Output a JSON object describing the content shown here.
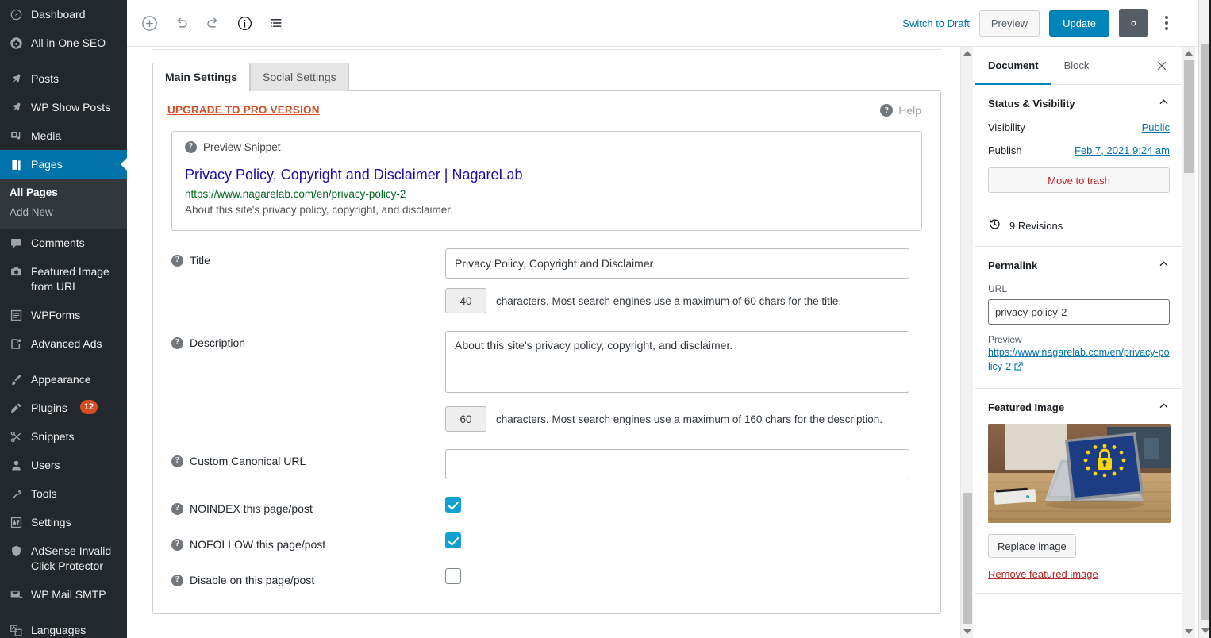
{
  "sidebar": {
    "items": [
      {
        "label": "Dashboard",
        "icon": "dashboard-icon",
        "active": false
      },
      {
        "label": "All in One SEO",
        "icon": "aioseo-icon",
        "active": false
      },
      {
        "label": "Posts",
        "icon": "pin-icon",
        "active": false
      },
      {
        "label": "WP Show Posts",
        "icon": "pin-icon",
        "active": false
      },
      {
        "label": "Media",
        "icon": "media-icon",
        "active": false
      },
      {
        "label": "Pages",
        "icon": "pages-icon",
        "active": true
      },
      {
        "label": "Comments",
        "icon": "comment-icon",
        "active": false
      },
      {
        "label": "Featured Image from URL",
        "icon": "camera-icon",
        "active": false
      },
      {
        "label": "WPForms",
        "icon": "form-icon",
        "active": false
      },
      {
        "label": "Advanced Ads",
        "icon": "ads-icon",
        "active": false
      },
      {
        "label": "Appearance",
        "icon": "brush-icon",
        "active": false
      },
      {
        "label": "Plugins",
        "icon": "plug-icon",
        "badge": "12",
        "active": false
      },
      {
        "label": "Snippets",
        "icon": "scissors-icon",
        "active": false
      },
      {
        "label": "Users",
        "icon": "user-icon",
        "active": false
      },
      {
        "label": "Tools",
        "icon": "wrench-icon",
        "active": false
      },
      {
        "label": "Settings",
        "icon": "sliders-icon",
        "active": false
      },
      {
        "label": "AdSense Invalid Click Protector",
        "icon": "shield-icon",
        "active": false
      },
      {
        "label": "WP Mail SMTP",
        "icon": "mail-icon",
        "active": false
      },
      {
        "label": "Languages",
        "icon": "languages-icon",
        "active": false
      }
    ],
    "submenu": {
      "all_pages": "All Pages",
      "add_new": "Add New"
    }
  },
  "toolbar": {
    "add_block_icon": "add-block-icon",
    "undo_icon": "undo-icon",
    "redo_icon": "redo-icon",
    "info_icon": "info-icon",
    "list_view_icon": "list-view-icon",
    "switch_to_draft": "Switch to Draft",
    "preview": "Preview",
    "update": "Update",
    "settings_icon": "gear-icon",
    "more_icon": "kebab-menu-icon"
  },
  "main": {
    "tabs": [
      {
        "label": "Main Settings",
        "active": true
      },
      {
        "label": "Social Settings",
        "active": false
      }
    ],
    "upgrade_label": "UPGRADE TO PRO VERSION",
    "help_label": "Help",
    "snippet": {
      "heading": "Preview Snippet",
      "title": "Privacy Policy, Copyright and Disclaimer | NagareLab",
      "url": "https://www.nagarelab.com/en/privacy-policy-2",
      "description": "About this site's privacy policy, copyright, and disclaimer."
    },
    "fields": {
      "title": {
        "label": "Title",
        "value": "Privacy Policy, Copyright and Disclaimer",
        "count": "40",
        "note": "characters. Most search engines use a maximum of 60 chars for the title."
      },
      "description": {
        "label": "Description",
        "value": "About this site's privacy policy, copyright, and disclaimer.",
        "count": "60",
        "note": "characters. Most search engines use a maximum of 160 chars for the description."
      },
      "canonical": {
        "label": "Custom Canonical URL",
        "value": ""
      },
      "noindex": {
        "label": "NOINDEX this page/post",
        "checked": true
      },
      "nofollow": {
        "label": "NOFOLLOW this page/post",
        "checked": true
      },
      "disable": {
        "label": "Disable on this page/post",
        "checked": false
      }
    }
  },
  "rpanel": {
    "tabs": [
      {
        "label": "Document",
        "active": true
      },
      {
        "label": "Block",
        "active": false
      }
    ],
    "close_icon": "close-icon",
    "status": {
      "heading": "Status & Visibility",
      "visibility_label": "Visibility",
      "visibility_value": "Public",
      "publish_label": "Publish",
      "publish_value": "Feb 7, 2021 9:24 am",
      "trash_label": "Move to trash"
    },
    "revisions": {
      "label": "9 Revisions",
      "icon": "history-icon"
    },
    "permalink": {
      "heading": "Permalink",
      "url_label": "URL",
      "url_value": "privacy-policy-2",
      "preview_label": "Preview",
      "preview_url": "https://www.nagarelab.com/en/privacy-policy-2"
    },
    "featured_image": {
      "heading": "Featured Image",
      "replace_label": "Replace image",
      "remove_label": "Remove featured image",
      "alt": "Laptop on wooden desk showing EU flag with padlock"
    }
  },
  "colors": {
    "sidebar_bg": "#23282d",
    "accent_blue": "#0073aa",
    "update_blue": "#0085ba",
    "upgrade_orange": "#d54e21",
    "checkbox_blue": "#11a0d2",
    "snippet_title": "#1a0dab",
    "snippet_url": "#006621",
    "trash_red": "#b52727"
  }
}
